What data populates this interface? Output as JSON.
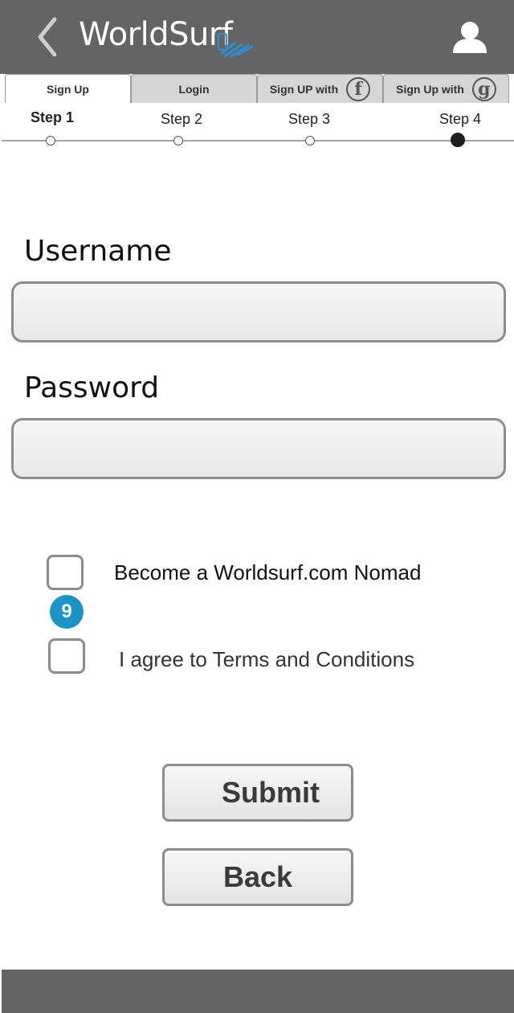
{
  "header": {
    "brand": "WorldSurf",
    "back_icon": "chevron-left-icon",
    "logo_icon": "worldsurf-logo-icon",
    "profile_icon": "user-icon"
  },
  "tabs": [
    {
      "label": "Sign Up",
      "active": true
    },
    {
      "label": "Login",
      "active": false
    },
    {
      "label": "Sign UP with",
      "icon": "facebook-icon",
      "glyph": "f"
    },
    {
      "label": "Sign Up with",
      "icon": "google-icon",
      "glyph": "g"
    }
  ],
  "steps": {
    "items": [
      "Step 1",
      "Step 2",
      "Step 3",
      "Step 4"
    ],
    "current": 4
  },
  "form": {
    "username_label": "Username",
    "username_value": "",
    "password_label": "Password",
    "password_value": ""
  },
  "options": {
    "nomad_label": "Become a Worldsurf.com Nomad",
    "nomad_checked": false,
    "badge": "9",
    "terms_label": "I agree to Terms and Conditions",
    "terms_checked": false
  },
  "buttons": {
    "submit": "Submit",
    "back": "Back"
  },
  "colors": {
    "header_bg": "#646464",
    "badge": "#1a93c7",
    "logo_accent": "#2b8fd0"
  }
}
